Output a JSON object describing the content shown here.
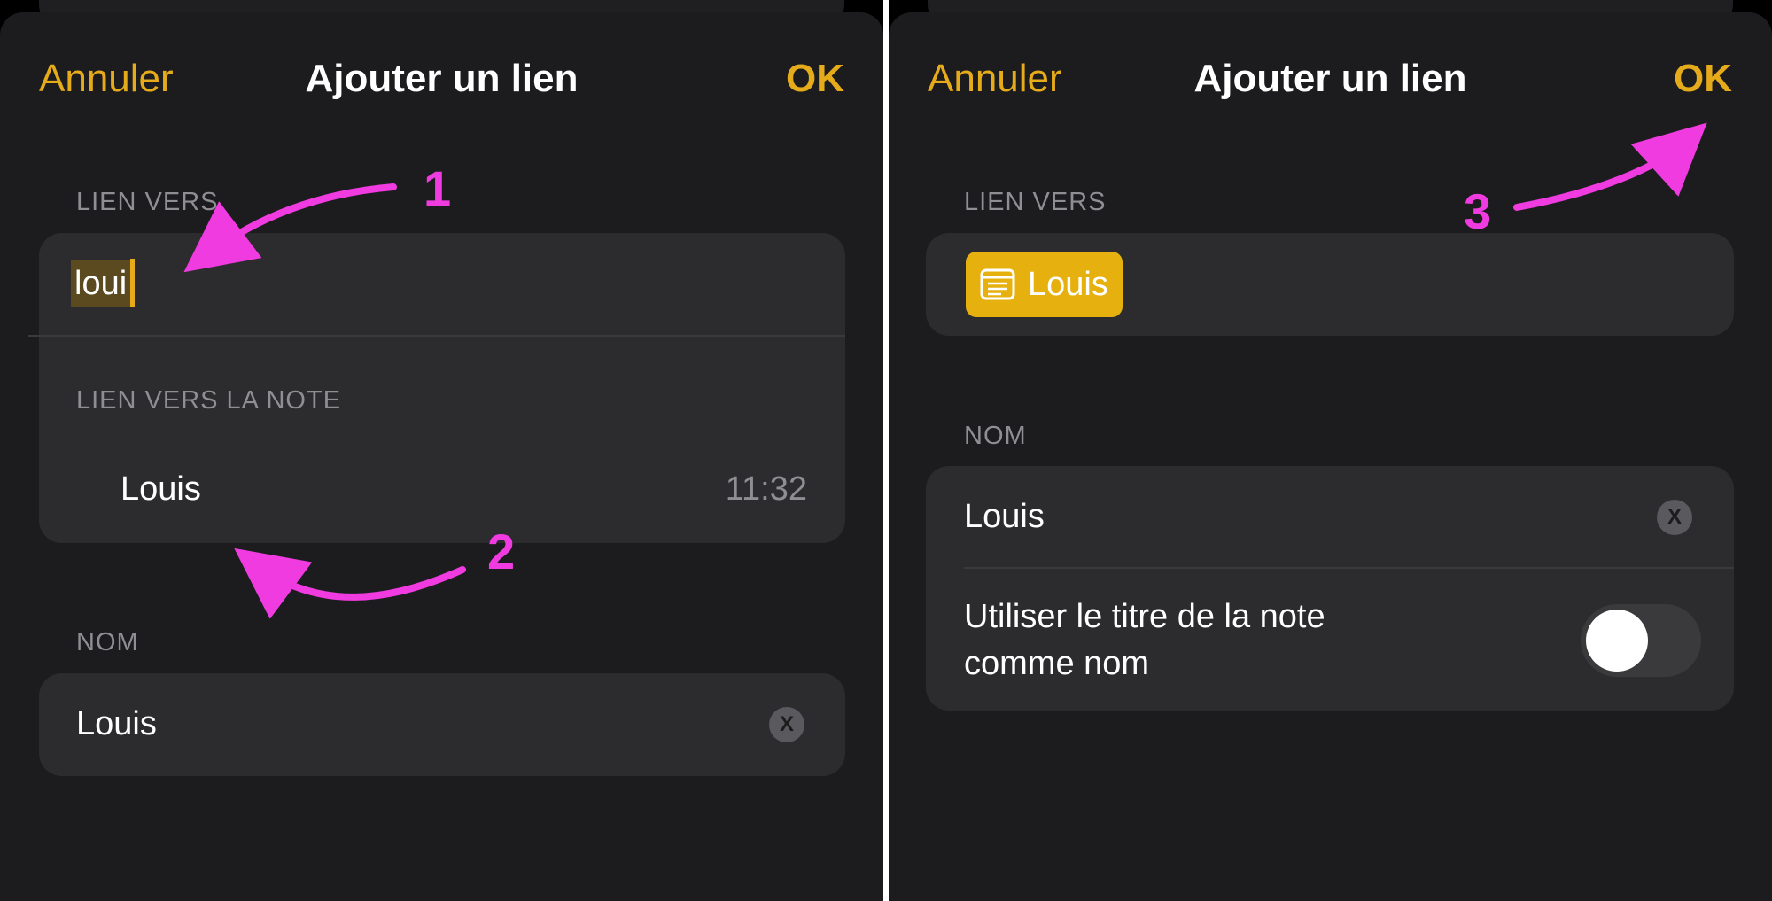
{
  "left_panel": {
    "nav": {
      "cancel": "Annuler",
      "title": "Ajouter un lien",
      "ok": "OK"
    },
    "link_to_label": "LIEN VERS",
    "search_text": "loui",
    "note_section_label": "LIEN VERS LA NOTE",
    "note_result": {
      "name": "Louis",
      "time": "11:32"
    },
    "name_label": "NOM",
    "name_value": "Louis",
    "clear_glyph": "X"
  },
  "right_panel": {
    "nav": {
      "cancel": "Annuler",
      "title": "Ajouter un lien",
      "ok": "OK"
    },
    "link_to_label": "LIEN VERS",
    "chip_label": "Louis",
    "name_label": "NOM",
    "name_value": "Louis",
    "clear_glyph": "X",
    "use_title_label_line1": "Utiliser le titre de la note",
    "use_title_label_line2": "comme nom",
    "use_title_toggle_on": false
  },
  "annotations": {
    "step1": "1",
    "step2": "2",
    "step3": "3"
  },
  "colors": {
    "accent": "#e6ab1b",
    "annotation": "#f03be0",
    "chip": "#e6b10f",
    "background": "#1c1c1e",
    "group": "#2c2c2e"
  },
  "icons": [
    "note-icon",
    "clear-icon"
  ]
}
